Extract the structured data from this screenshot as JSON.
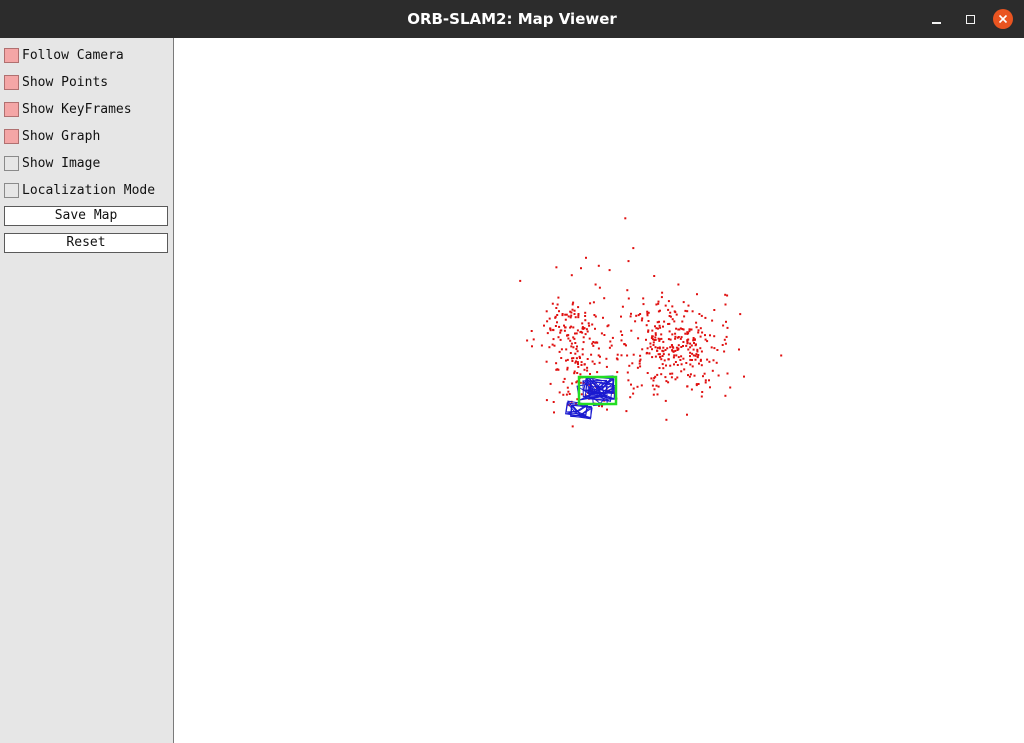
{
  "window": {
    "title": "ORB-SLAM2: Map Viewer",
    "controls": {
      "minimize": "minimize-icon",
      "maximize": "maximize-icon",
      "close": "close-icon"
    }
  },
  "panel": {
    "checkboxes": [
      {
        "label": "Follow Camera",
        "checked": true
      },
      {
        "label": "Show Points",
        "checked": true
      },
      {
        "label": "Show KeyFrames",
        "checked": true
      },
      {
        "label": "Show Graph",
        "checked": true
      },
      {
        "label": "Show Image",
        "checked": false
      },
      {
        "label": "Localization Mode",
        "checked": false
      }
    ],
    "buttons": {
      "save_map": "Save Map",
      "reset": "Reset"
    }
  },
  "colors": {
    "map_points": "#e01010",
    "keyframes": "#1a1ad0",
    "current_camera": "#22dd22",
    "checkbox_checked": "#f4a6a6",
    "close_button": "#e95420"
  }
}
